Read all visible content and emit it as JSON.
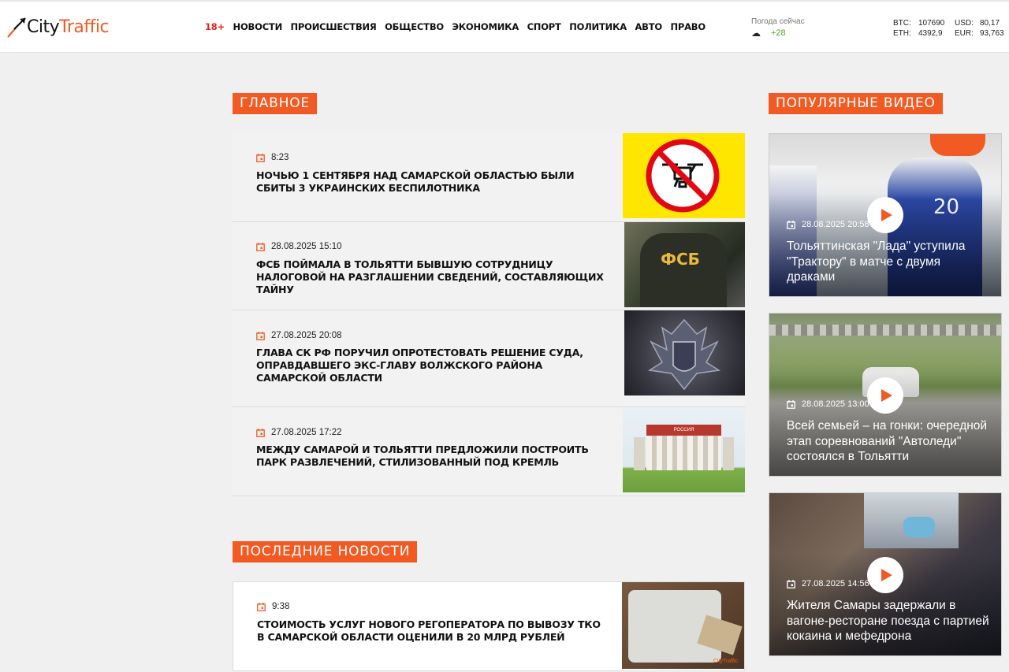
{
  "header": {
    "logo_part1": "City",
    "logo_part2": "Traffic",
    "nav": {
      "age": "18+",
      "items": [
        "Новости",
        "Происшествия",
        "Общество",
        "Экономика",
        "Спорт",
        "Политика",
        "Авто",
        "Право"
      ]
    },
    "weather": {
      "label": "Погода сейчас",
      "temp": "+28"
    },
    "rates": {
      "btc_label": "BTC:",
      "btc_value": "107690",
      "eth_label": "ETH:",
      "eth_value": "4392,9",
      "usd_label": "USD:",
      "usd_value": "80,17",
      "eur_label": "EUR:",
      "eur_value": "93,763"
    }
  },
  "main": {
    "title": "Главное",
    "items": [
      {
        "time": "8:23",
        "title": "Ночью 1 сентября над Самарской областью были сбиты 3 украинских беспилотника"
      },
      {
        "time": "28.08.2025 15:10",
        "title": "ФСБ поймала в Тольятти бывшую сотрудницу налоговой на разглашении сведений, составляющих тайну",
        "thumb_text": "ФСБ"
      },
      {
        "time": "27.08.2025 20:08",
        "title": "Глава СК РФ поручил опротестовать решение суда, оправдавшего экс-главу Волжского района Самарской области"
      },
      {
        "time": "27.08.2025 17:22",
        "title": "Между Самарой и Тольятти предложили построить парк развлечений, стилизованный под кремль",
        "thumb_text": "РОССИЯ"
      }
    ]
  },
  "latest": {
    "title": "Последние новости",
    "items": [
      {
        "time": "9:38",
        "title": "Стоимость услуг нового регоператора по вывозу ТКО в Самарской области оценили в 20 млрд рублей",
        "thumb_text": "CityTraffic"
      }
    ]
  },
  "videos": {
    "title": "Популярные видео",
    "items": [
      {
        "date": "28.08.2025 20:58",
        "title": "Тольяттинская \"Лада\" уступила \"Трактору\" в матче с двумя драками",
        "jersey_number": "20"
      },
      {
        "date": "28.08.2025 13:00",
        "title": "Всей семьей – на гонки: очередной этап соревнований \"Автоледи\" состоялся в Тольятти"
      },
      {
        "date": "27.08.2025 14:56",
        "title": "Жителя Самары задержали в вагоне-ресторане поезда с партией кокаина и мефедрона"
      }
    ]
  },
  "colors": {
    "accent": "#f15a22",
    "age_red": "#e2231a",
    "temp_green": "#4caa2a"
  }
}
